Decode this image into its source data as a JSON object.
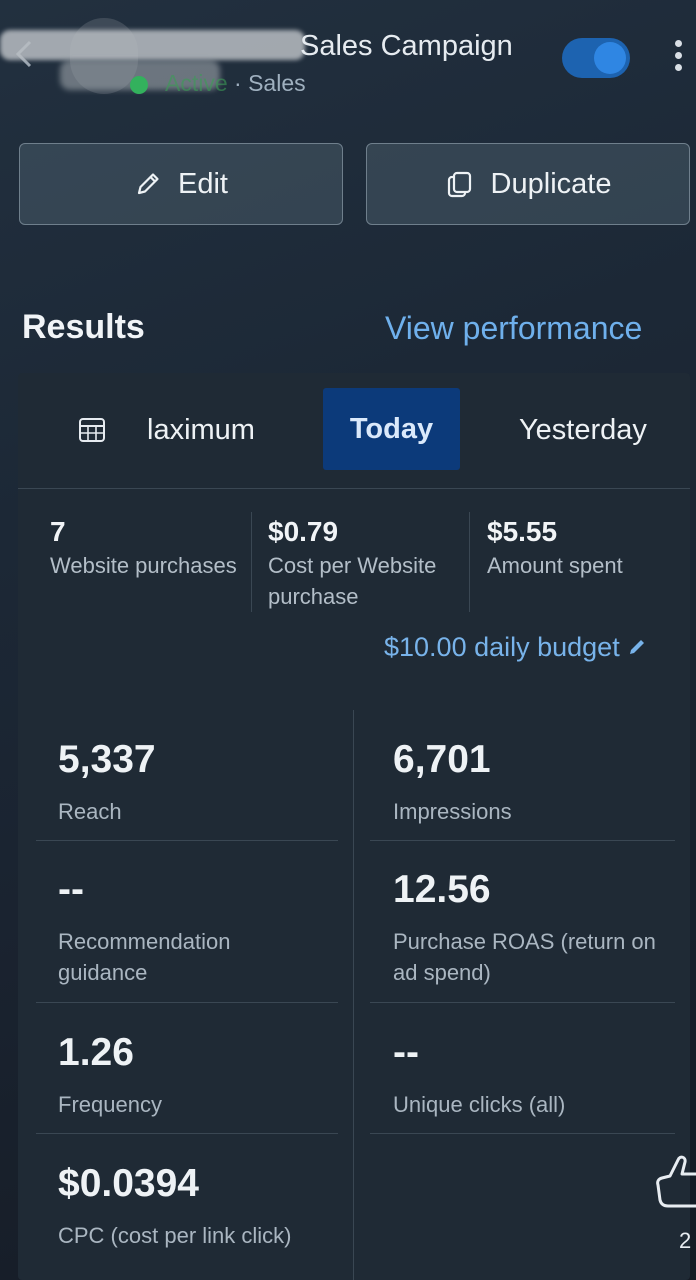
{
  "header": {
    "back_icon": "chevron-left-icon",
    "title": "Sales Campaign",
    "status": "Active",
    "separator": "·",
    "objective": "Sales",
    "toggle_on": true,
    "more_icon": "kebab-icon"
  },
  "actions": {
    "edit_label": "Edit",
    "duplicate_label": "Duplicate"
  },
  "results": {
    "title": "Results",
    "view_performance": "View performance",
    "tabs": {
      "maximum": "laximum",
      "today": "Today",
      "yesterday": "Yesterday",
      "selected": "Today"
    },
    "summary": [
      {
        "value": "7",
        "label": "Website purchases"
      },
      {
        "value": "$0.79",
        "label": "Cost per Website purchase"
      },
      {
        "value": "$5.55",
        "label": "Amount spent"
      }
    ],
    "budget": "$10.00 daily budget",
    "metrics": [
      {
        "value": "5,337",
        "label": "Reach"
      },
      {
        "value": "6,701",
        "label": "Impressions"
      },
      {
        "value": "--",
        "label": "Recommendation guidance"
      },
      {
        "value": "12.56",
        "label": "Purchase ROAS (return on ad spend)"
      },
      {
        "value": "1.26",
        "label": "Frequency"
      },
      {
        "value": "--",
        "label": "Unique clicks (all)"
      },
      {
        "value": "$0.0394",
        "label": "CPC (cost per link click)"
      }
    ]
  },
  "reaction": {
    "icon": "thumbs-up-icon",
    "count": "2"
  },
  "colors": {
    "accent": "#6fb0ec",
    "selected_tab": "#0c3a7a",
    "active_green": "#33b15d"
  }
}
